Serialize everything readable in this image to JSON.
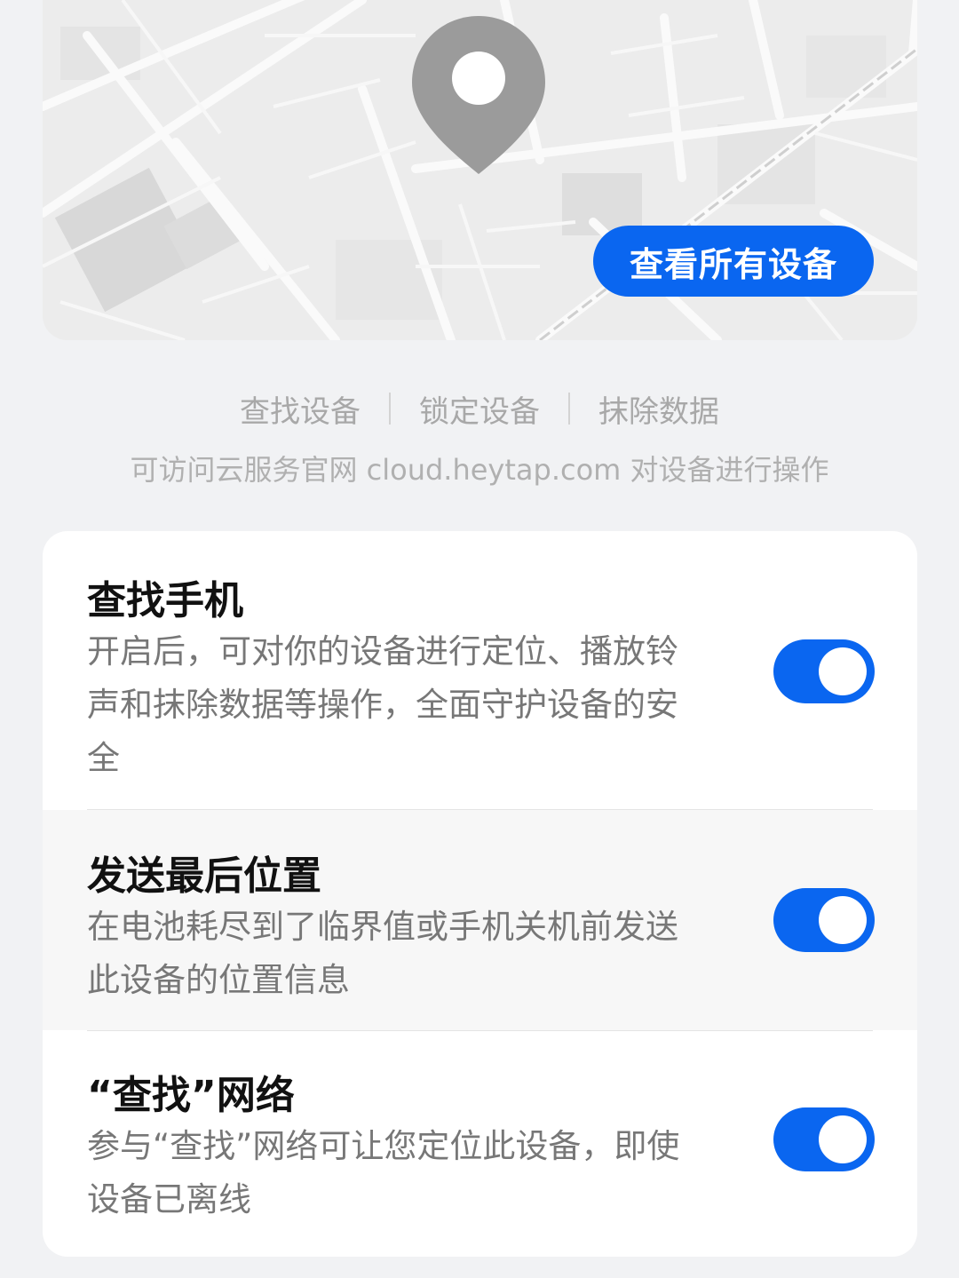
{
  "map": {
    "view_all_label": "查看所有设备"
  },
  "actions": [
    {
      "label": "查找设备"
    },
    {
      "label": "锁定设备"
    },
    {
      "label": "抹除数据"
    }
  ],
  "hint": "可访问云服务官网 cloud.heytap.com 对设备进行操作",
  "settings": [
    {
      "title": "查找手机",
      "description": "开启后，可对你的设备进行定位、播放铃声和抹除数据等操作，全面守护设备的安全",
      "enabled": true
    },
    {
      "title": "发送最后位置",
      "description": "在电池耗尽到了临界值或手机关机前发送此设备的位置信息",
      "enabled": true
    },
    {
      "title": "“查找”网络",
      "description": "参与“查找”网络可让您定位此设备，即使设备已离线",
      "enabled": true
    }
  ],
  "colors": {
    "accent": "#0a66f0",
    "background": "#f1f2f4",
    "card": "#ffffff"
  }
}
